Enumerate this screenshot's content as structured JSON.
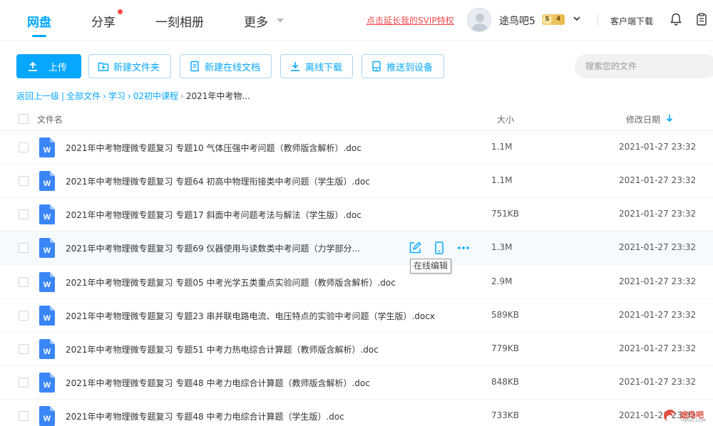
{
  "nav": {
    "items": [
      {
        "label": "网盘",
        "active": true
      },
      {
        "label": "分享",
        "has_dot": true
      },
      {
        "label": "一刻相册"
      },
      {
        "label": "更多",
        "has_caret": true
      }
    ]
  },
  "header": {
    "svip_link": "点击延长我的SVIP特权",
    "username": "途鸟吧5",
    "badge_letter": "S",
    "badge_level": "4",
    "client_download": "客户端下载",
    "accent_color": "#06a7ff"
  },
  "toolbar": {
    "upload": "上传",
    "new_folder": "新建文件夹",
    "new_online_doc": "新建在线文档",
    "offline_download": "离线下载",
    "push_to_device": "推送到设备",
    "search_placeholder": "搜索您的文件"
  },
  "breadcrumb": {
    "back": "返回上一级",
    "items": [
      "全部文件",
      "学习",
      "02初中课程",
      "2021年中考物..."
    ]
  },
  "table": {
    "col_name": "文件名",
    "col_size": "大小",
    "col_date": "修改日期",
    "rows": [
      {
        "name": "2021年中考物理微专题复习 专题10 气体压强中考问题（教师版含解析）.doc",
        "size": "1.1M",
        "date": "2021-01-27 23:32"
      },
      {
        "name": "2021年中考物理微专题复习 专题64 初高中物理衔接类中考问题（学生版）.doc",
        "size": "1.1M",
        "date": "2021-01-27 23:32"
      },
      {
        "name": "2021年中考物理微专题复习 专题17 斜面中考问题考法与解法（学生版）.doc",
        "size": "751KB",
        "date": "2021-01-27 23:32"
      },
      {
        "name": "2021年中考物理微专题复习 专题69 仪器使用与读数类中考问题（力学部分...",
        "size": "1.3M",
        "date": "2021-01-27 23:32",
        "hover": true
      },
      {
        "name": "2021年中考物理微专题复习 专题05 中考光学五类重点实验问题（教师版含解析）.doc",
        "size": "2.9M",
        "date": "2021-01-27 23:32"
      },
      {
        "name": "2021年中考物理微专题复习 专题23 串并联电路电流、电压特点的实验中考问题（学生版）.docx",
        "size": "589KB",
        "date": "2021-01-27 23:32"
      },
      {
        "name": "2021年中考物理微专题复习 专题51 中考力热电综合计算题（教师版含解析）.doc",
        "size": "779KB",
        "date": "2021-01-27 23:32"
      },
      {
        "name": "2021年中考物理微专题复习 专题48 中考力电综合计算题（教师版含解析）.doc",
        "size": "848KB",
        "date": "2021-01-27 23:32"
      },
      {
        "name": "2021年中考物理微专题复习 专题48 中考力电综合计算题（学生版）.doc",
        "size": "733KB",
        "date": "2021-01-27 23:32"
      }
    ],
    "tooltip": "在线编辑"
  },
  "watermark": {
    "text": "途鸟吧",
    "sub": "TNREE.COM"
  }
}
